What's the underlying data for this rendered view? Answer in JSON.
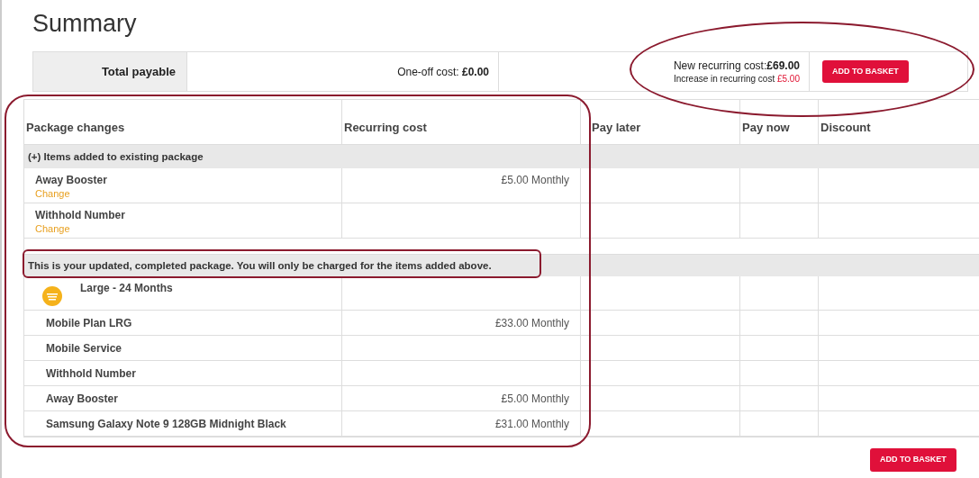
{
  "title": "Summary",
  "summary": {
    "total_label": "Total payable",
    "one_off_label": "One-off cost: ",
    "one_off_value": "£0.00",
    "recurring_label": "New recurring cost:",
    "recurring_value": "£69.00",
    "increase_label": "Increase in recurring cost ",
    "increase_value": "£5.00",
    "button": "ADD TO BASKET"
  },
  "table": {
    "columns": [
      "Package changes",
      "Recurring cost",
      "Pay later",
      "Pay now",
      "Discount"
    ],
    "sections": [
      {
        "title": "(+) Items added to existing package",
        "rows": [
          {
            "kind": "change",
            "name": "Away Booster",
            "link": "Change",
            "cost": "£5.00 Monthly"
          },
          {
            "kind": "change",
            "name": "Withhold Number",
            "link": "Change"
          }
        ]
      },
      {
        "title": "This is your updated, completed package. You will only be charged for the items added above.",
        "rows": [
          {
            "kind": "plan",
            "name": "Large - 24 Months"
          },
          {
            "kind": "item",
            "name": "Mobile Plan LRG",
            "cost": "£33.00 Monthly"
          },
          {
            "kind": "item",
            "name": "Mobile Service"
          },
          {
            "kind": "item",
            "name": "Withhold Number"
          },
          {
            "kind": "item",
            "name": "Away Booster",
            "cost": "£5.00 Monthly"
          },
          {
            "kind": "item",
            "name": "Samsung Galaxy Note 9 128GB Midnight Black",
            "cost": "£31.00 Monthly"
          }
        ]
      }
    ]
  },
  "footer_button": "ADD TO BASKET"
}
